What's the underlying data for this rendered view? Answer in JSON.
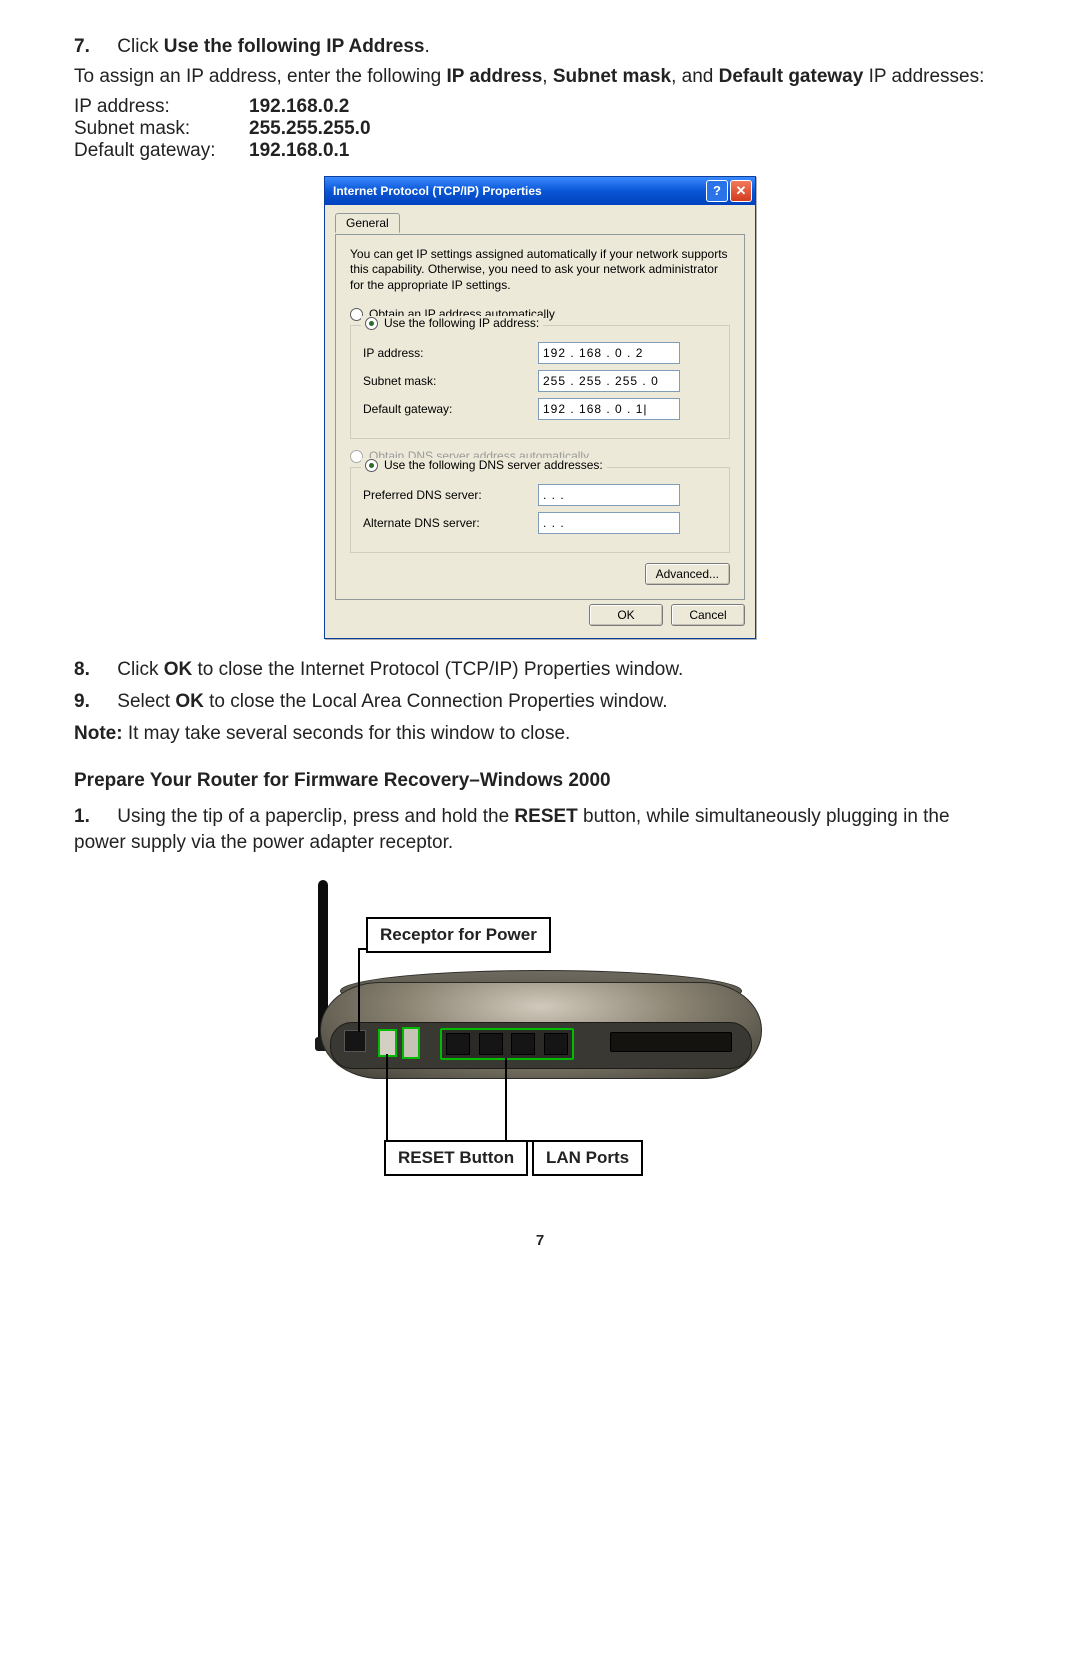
{
  "steps": {
    "s7": {
      "num": "7.",
      "text_pre": "Click ",
      "bold": "Use the following IP Address",
      "after": "."
    },
    "assign_pre": "To assign an IP address, enter the following ",
    "assign_b1": "IP address",
    "assign_mid": ", ",
    "assign_b2": "Subnet mask",
    "assign_mid2": ", and ",
    "assign_b3": "Default gateway",
    "assign_end": " IP addresses:",
    "rows": [
      {
        "label": "IP address:",
        "val": "192.168.0.2"
      },
      {
        "label": "Subnet mask:",
        "val": "255.255.255.0"
      },
      {
        "label": "Default gateway:",
        "val": "192.168.0.1"
      }
    ],
    "s8": {
      "num": "8.",
      "pre": "Click ",
      "b": "OK",
      "post": " to close the Internet Protocol (TCP/IP) Properties window."
    },
    "s9": {
      "num": "9.",
      "pre": "Select ",
      "b": "OK",
      "post": " to close the Local Area Connection Properties window."
    },
    "note_b": "Note:",
    "note_t": " It may take several seconds for this window to close."
  },
  "dialog": {
    "title": "Internet Protocol (TCP/IP) Properties",
    "help": "?",
    "close": "✕",
    "tab": "General",
    "info": "You can get IP settings assigned automatically if your network supports this capability. Otherwise, you need to ask your network administrator for the appropriate IP settings.",
    "r1": "Obtain an IP address automatically",
    "r2": "Use the following IP address:",
    "f_ip": "IP address:",
    "v_ip": "192 . 168 .   0   .   2",
    "f_sm": "Subnet mask:",
    "v_sm": "255 . 255 . 255 .   0",
    "f_gw": "Default gateway:",
    "v_gw": "192 . 168 .   0   .   1|",
    "r3": "Obtain DNS server address automatically",
    "r4": "Use the following DNS server addresses:",
    "f_pdns": "Preferred DNS server:",
    "v_pdns": "   .       .       .   ",
    "f_adns": "Alternate DNS server:",
    "v_adns": "   .       .       .   ",
    "adv": "Advanced...",
    "ok": "OK",
    "cancel": "Cancel"
  },
  "section_heading": "Prepare Your Router for Firmware Recovery–Windows 2000",
  "router_step": {
    "num": "1.",
    "pre": "Using the tip of a paperclip, press and hold the ",
    "b": "RESET",
    "post": " button, while simultaneously plugging in the power supply via the power adapter receptor."
  },
  "callouts": {
    "power": "Receptor for Power",
    "reset": "RESET Button",
    "lan": "LAN Ports"
  },
  "page_number": "7"
}
